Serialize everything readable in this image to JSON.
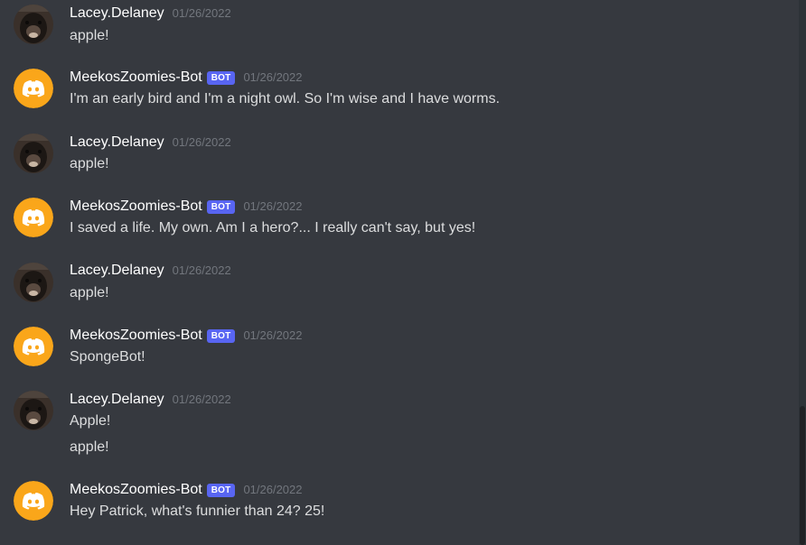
{
  "colors": {
    "background": "#36393f",
    "bot_avatar": "#faa61a",
    "bot_tag": "#5865f2",
    "username": "#ffffff",
    "timestamp": "#72767d",
    "message_text": "#dcddde"
  },
  "messages": [
    {
      "author": "Lacey.Delaney",
      "is_bot": false,
      "avatar_icon": "dog-photo-avatar",
      "timestamp": "01/26/2022",
      "lines": [
        "apple!"
      ]
    },
    {
      "author": "MeekosZoomies-Bot",
      "is_bot": true,
      "bot_tag": "BOT",
      "avatar_icon": "discord-logo-icon",
      "timestamp": "01/26/2022",
      "lines": [
        "I'm an early bird and I'm a night owl. So I'm wise and I have worms."
      ]
    },
    {
      "author": "Lacey.Delaney",
      "is_bot": false,
      "avatar_icon": "dog-photo-avatar",
      "timestamp": "01/26/2022",
      "lines": [
        "apple!"
      ]
    },
    {
      "author": "MeekosZoomies-Bot",
      "is_bot": true,
      "bot_tag": "BOT",
      "avatar_icon": "discord-logo-icon",
      "timestamp": "01/26/2022",
      "lines": [
        "I saved a life. My own. Am I a hero?... I really can't say, but yes!"
      ]
    },
    {
      "author": "Lacey.Delaney",
      "is_bot": false,
      "avatar_icon": "dog-photo-avatar",
      "timestamp": "01/26/2022",
      "lines": [
        "apple!"
      ]
    },
    {
      "author": "MeekosZoomies-Bot",
      "is_bot": true,
      "bot_tag": "BOT",
      "avatar_icon": "discord-logo-icon",
      "timestamp": "01/26/2022",
      "lines": [
        "SpongeBot!"
      ]
    },
    {
      "author": "Lacey.Delaney",
      "is_bot": false,
      "avatar_icon": "dog-photo-avatar",
      "timestamp": "01/26/2022",
      "lines": [
        "Apple!",
        "apple!"
      ]
    },
    {
      "author": "MeekosZoomies-Bot",
      "is_bot": true,
      "bot_tag": "BOT",
      "avatar_icon": "discord-logo-icon",
      "timestamp": "01/26/2022",
      "lines": [
        "Hey Patrick, what's funnier than 24? 25!"
      ]
    }
  ]
}
